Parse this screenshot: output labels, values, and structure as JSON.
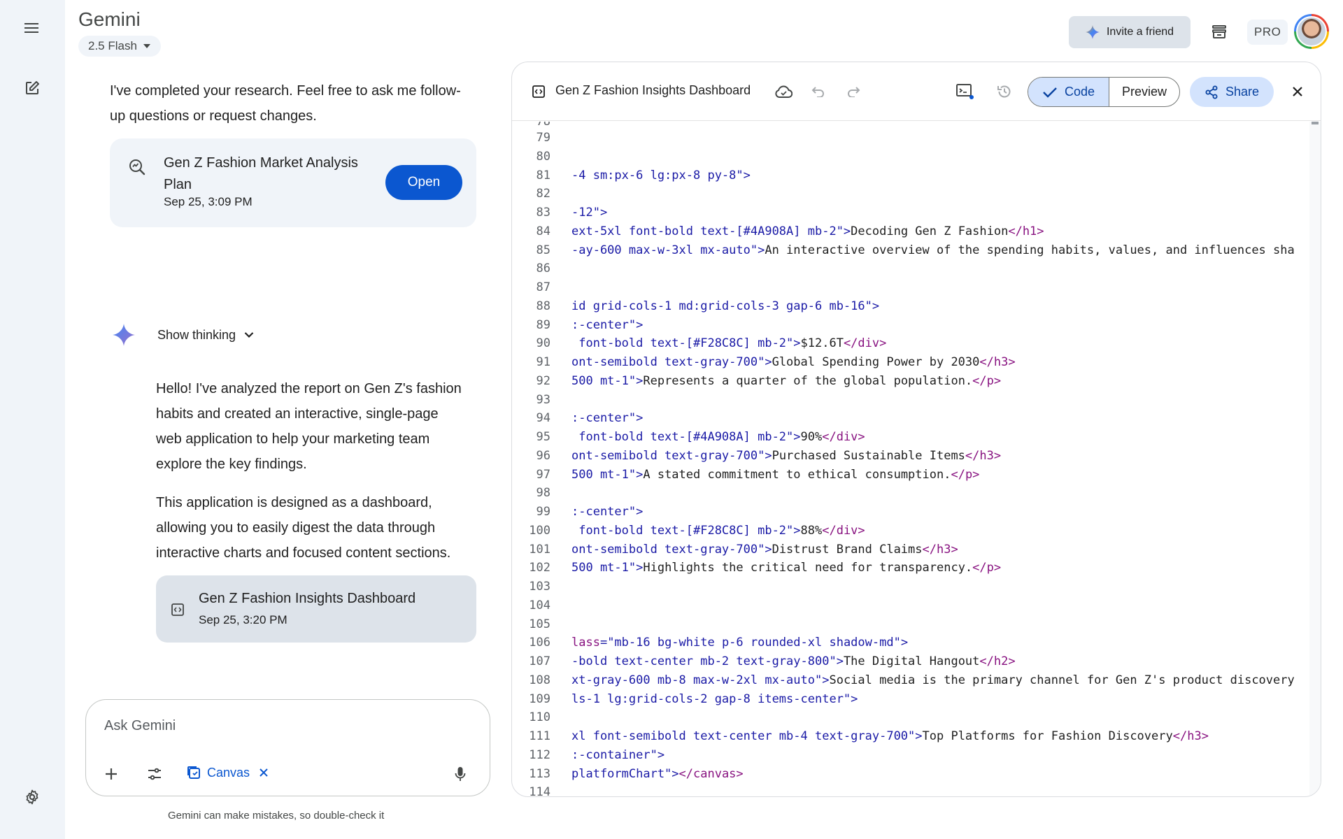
{
  "app": {
    "title": "Gemini",
    "model": "2.5 Flash"
  },
  "header": {
    "invite_label": "Invite a friend",
    "pro_label": "PRO"
  },
  "chat": {
    "message1": [
      "I've completed your research. Feel free to ask me follow-",
      "up questions or request changes."
    ],
    "research_card": {
      "title_lines": [
        "Gen Z Fashion Market Analysis",
        "Plan"
      ],
      "date": "Sep 25, 3:09 PM",
      "open_label": "Open"
    },
    "thinking_label": "Show thinking",
    "paragraph1": [
      "Hello! I've analyzed the report on Gen Z's fashion",
      "habits and created an interactive, single-page",
      "web application to help your marketing team",
      "explore the key findings."
    ],
    "paragraph2": [
      "This application is designed as a dashboard,",
      "allowing you to easily digest the data through",
      "interactive charts and focused content sections."
    ],
    "dashboard_card": {
      "title": "Gen Z Fashion Insights Dashboard",
      "date": "Sep 25, 3:20 PM"
    }
  },
  "input": {
    "placeholder": "Ask Gemini",
    "canvas_label": "Canvas"
  },
  "disclaimer": "Gemini can make mistakes, so double-check it",
  "canvas": {
    "title": "Gen Z Fashion Insights Dashboard",
    "code_label": "Code",
    "preview_label": "Preview",
    "share_label": "Share",
    "lines": [
      {
        "n": "79",
        "segs": []
      },
      {
        "n": "80",
        "segs": []
      },
      {
        "n": "81",
        "segs": [
          [
            "a",
            "-4 sm:px-6 lg:px-8 py-8\">"
          ]
        ]
      },
      {
        "n": "82",
        "segs": []
      },
      {
        "n": "83",
        "segs": [
          [
            "a",
            "-12\">"
          ]
        ]
      },
      {
        "n": "84",
        "segs": [
          [
            "a",
            "ext-5xl font-bold text-[#4A908A] mb-2\">"
          ],
          [
            "t",
            "Decoding Gen Z Fashion"
          ],
          [
            "g",
            "</h1>"
          ]
        ]
      },
      {
        "n": "85",
        "segs": [
          [
            "a",
            "-ay-600 max-w-3xl mx-auto\">"
          ],
          [
            "t",
            "An interactive overview of the spending habits, values, and influences sha"
          ]
        ]
      },
      {
        "n": "86",
        "segs": []
      },
      {
        "n": "87",
        "segs": []
      },
      {
        "n": "88",
        "segs": [
          [
            "a",
            "id grid-cols-1 md:grid-cols-3 gap-6 mb-16\">"
          ]
        ]
      },
      {
        "n": "89",
        "segs": [
          [
            "a",
            ":-center\">"
          ]
        ]
      },
      {
        "n": "90",
        "segs": [
          [
            "a",
            " font-bold text-[#F28C8C] mb-2\">"
          ],
          [
            "t",
            "$12.6T"
          ],
          [
            "g",
            "</div>"
          ]
        ]
      },
      {
        "n": "91",
        "segs": [
          [
            "a",
            "ont-semibold text-gray-700\">"
          ],
          [
            "t",
            "Global Spending Power by 2030"
          ],
          [
            "g",
            "</h3>"
          ]
        ]
      },
      {
        "n": "92",
        "segs": [
          [
            "a",
            "500 mt-1\">"
          ],
          [
            "t",
            "Represents a quarter of the global population."
          ],
          [
            "g",
            "</p>"
          ]
        ]
      },
      {
        "n": "93",
        "segs": []
      },
      {
        "n": "94",
        "segs": [
          [
            "a",
            ":-center\">"
          ]
        ]
      },
      {
        "n": "95",
        "segs": [
          [
            "a",
            " font-bold text-[#4A908A] mb-2\">"
          ],
          [
            "t",
            "90%"
          ],
          [
            "g",
            "</div>"
          ]
        ]
      },
      {
        "n": "96",
        "segs": [
          [
            "a",
            "ont-semibold text-gray-700\">"
          ],
          [
            "t",
            "Purchased Sustainable Items"
          ],
          [
            "g",
            "</h3>"
          ]
        ]
      },
      {
        "n": "97",
        "segs": [
          [
            "a",
            "500 mt-1\">"
          ],
          [
            "t",
            "A stated commitment to ethical consumption."
          ],
          [
            "g",
            "</p>"
          ]
        ]
      },
      {
        "n": "98",
        "segs": []
      },
      {
        "n": "99",
        "segs": [
          [
            "a",
            ":-center\">"
          ]
        ]
      },
      {
        "n": "100",
        "segs": [
          [
            "a",
            " font-bold text-[#F28C8C] mb-2\">"
          ],
          [
            "t",
            "88%"
          ],
          [
            "g",
            "</div>"
          ]
        ]
      },
      {
        "n": "101",
        "segs": [
          [
            "a",
            "ont-semibold text-gray-700\">"
          ],
          [
            "t",
            "Distrust Brand Claims"
          ],
          [
            "g",
            "</h3>"
          ]
        ]
      },
      {
        "n": "102",
        "segs": [
          [
            "a",
            "500 mt-1\">"
          ],
          [
            "t",
            "Highlights the critical need for transparency."
          ],
          [
            "g",
            "</p>"
          ]
        ]
      },
      {
        "n": "103",
        "segs": []
      },
      {
        "n": "104",
        "segs": []
      },
      {
        "n": "105",
        "segs": []
      },
      {
        "n": "106",
        "segs": [
          [
            "g",
            "lass"
          ],
          [
            "a",
            "=\"mb-16 bg-white p-6 rounded-xl shadow-md\">"
          ]
        ]
      },
      {
        "n": "107",
        "segs": [
          [
            "a",
            "-bold text-center mb-2 text-gray-800\">"
          ],
          [
            "t",
            "The Digital Hangout"
          ],
          [
            "g",
            "</h2>"
          ]
        ]
      },
      {
        "n": "108",
        "segs": [
          [
            "a",
            "xt-gray-600 mb-8 max-w-2xl mx-auto\">"
          ],
          [
            "t",
            "Social media is the primary channel for Gen Z's product discovery"
          ]
        ]
      },
      {
        "n": "109",
        "segs": [
          [
            "a",
            "ls-1 lg:grid-cols-2 gap-8 items-center\">"
          ]
        ]
      },
      {
        "n": "110",
        "segs": []
      },
      {
        "n": "111",
        "segs": [
          [
            "a",
            "xl font-semibold text-center mb-4 text-gray-700\">"
          ],
          [
            "t",
            "Top Platforms for Fashion Discovery"
          ],
          [
            "g",
            "</h3>"
          ]
        ]
      },
      {
        "n": "112",
        "segs": [
          [
            "a",
            ":-container\">"
          ]
        ]
      },
      {
        "n": "113",
        "segs": [
          [
            "a",
            "platformChart\">"
          ],
          [
            "g",
            "</canvas>"
          ]
        ]
      },
      {
        "n": "114",
        "segs": []
      }
    ]
  },
  "colors": {
    "accent": "#0b57d0",
    "chip_bg": "#d3e3fd",
    "rail_bg": "#f0f4f9",
    "card_bg": "#dde3ea"
  },
  "icons": [
    "menu-icon",
    "new-chat-icon",
    "settings-icon",
    "sparkle-icon",
    "archive-icon",
    "research-icon",
    "gemini-spark-icon",
    "chevron-down-icon",
    "code-doc-icon",
    "plus-icon",
    "tools-icon",
    "canvas-icon",
    "close-icon",
    "mic-icon",
    "cloud-save-icon",
    "undo-icon",
    "redo-icon",
    "console-icon",
    "history-icon",
    "check-icon",
    "share-icon"
  ]
}
